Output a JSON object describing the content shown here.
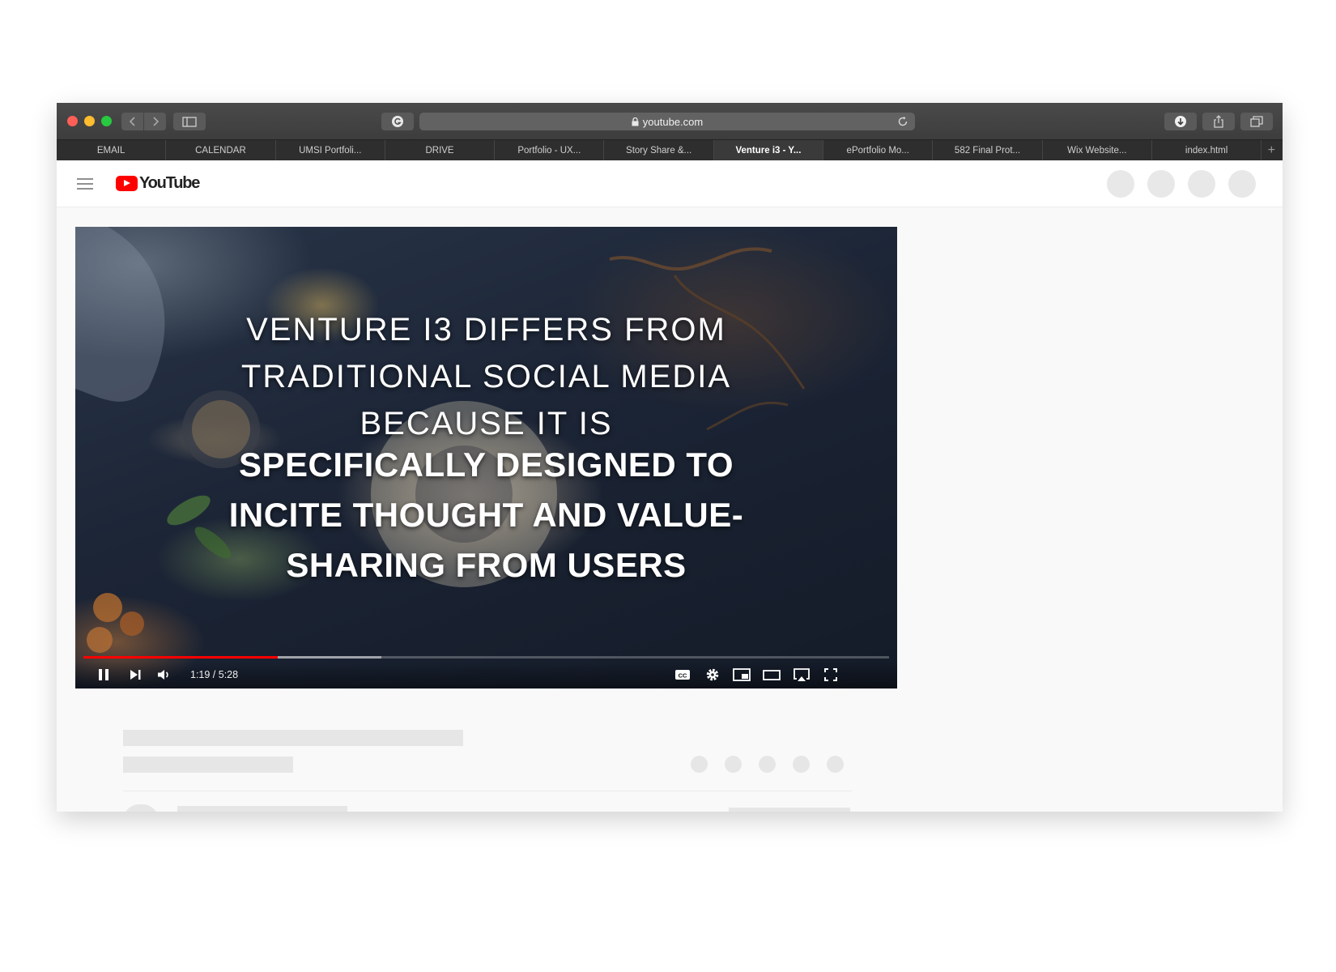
{
  "browser": {
    "url": "youtube.com",
    "tabs": [
      {
        "label": "EMAIL",
        "active": false
      },
      {
        "label": "CALENDAR",
        "active": false
      },
      {
        "label": "UMSI Portfoli...",
        "active": false
      },
      {
        "label": "DRIVE",
        "active": false
      },
      {
        "label": "Portfolio - UX...",
        "active": false
      },
      {
        "label": "Story Share &...",
        "active": false
      },
      {
        "label": "Venture i3 - Y...",
        "active": true
      },
      {
        "label": "ePortfolio Mo...",
        "active": false
      },
      {
        "label": "582 Final Prot...",
        "active": false
      },
      {
        "label": "Wix Website...",
        "active": false
      },
      {
        "label": "index.html",
        "active": false
      }
    ],
    "new_tab_symbol": "+"
  },
  "youtube": {
    "logo_text": "YouTube"
  },
  "video": {
    "caption_lines_top": [
      "VENTURE I3 DIFFERS FROM",
      "TRADITIONAL SOCIAL MEDIA",
      "BECAUSE IT IS"
    ],
    "caption_lines_bottom": [
      "SPECIFICALLY DESIGNED TO",
      "INCITE THOUGHT AND VALUE-",
      "SHARING FROM USERS"
    ],
    "time_display": "1:19 / 5:28",
    "played_fraction": 0.241,
    "buffered_fraction": 0.37
  },
  "colors": {
    "brand_red": "#ff0000",
    "titlebar": "#3d3d3d",
    "skeleton": "#e6e6e6"
  }
}
